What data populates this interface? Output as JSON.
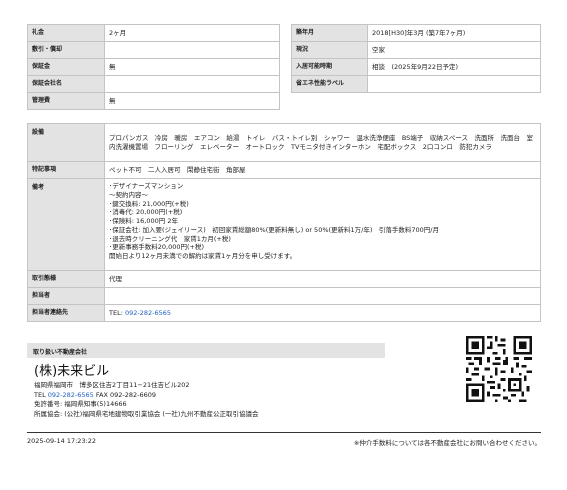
{
  "left_rows": [
    {
      "label": "礼金",
      "value": "2ヶ月"
    },
    {
      "label": "敷引・償却",
      "value": ""
    },
    {
      "label": "保証金",
      "value": "無"
    },
    {
      "label": "保証会社名",
      "value": ""
    },
    {
      "label": "管理費",
      "value": "無"
    }
  ],
  "right_rows": [
    {
      "label": "築年月",
      "value": "2018[H30]年3月 (築7年7ヶ月)"
    },
    {
      "label": "現況",
      "value": "空家"
    },
    {
      "label": "入居可能時期",
      "value": "相談　(2025年9月22日予定)"
    },
    {
      "label": "省エネ性能ラベル",
      "value": ""
    }
  ],
  "facilities": {
    "label": "設備",
    "value": "プロパンガス　冷房　暖房　エアコン　給湯　トイレ　バス・トイレ別　シャワー　温水洗浄便座　BS端子　収納スペース　洗面所　洗面台　室内洗濯機置場　フローリング　エレベーター　オートロック　TVモニタ付きインターホン　宅配ボックス　2口コンロ　防犯カメラ"
  },
  "special": {
    "label": "特記事項",
    "value": "ペット不可　二人入居可　閑静住宅街　角部屋"
  },
  "remarks": {
    "label": "備考",
    "lines": [
      "･デザイナーズマンション",
      "～契約内容～",
      "･鍵交換料: 21,000円(+税)",
      "･消毒代: 20,000円(+税)",
      "･保険料: 16,000円 2年",
      "･保証会社: 加入要(ジェイリース)　初回家賃総額80%(更新料無し) or 50%(更新料1万/年)　引落手数料700円/月",
      "･退去時クリーニング代　家賃1カ月(+税)",
      "･更新事務手数料20,000円(+税)",
      "開始日より12ヶ月未満での解約は家賃1ヶ月分を申し受けます。"
    ]
  },
  "transaction": {
    "label": "取引態様",
    "value": "代理"
  },
  "contact_person": {
    "label": "担当者",
    "value": ""
  },
  "contact_info": {
    "label": "担当者連絡先",
    "tel_prefix": "TEL: ",
    "tel": "092-282-6565"
  },
  "company": {
    "section_label": "取り扱い不動産会社",
    "name": "(株)未来ビル",
    "address": "福岡県福岡市　博多区住吉2丁目11−21住吉ビル202",
    "tel_prefix": "TEL ",
    "tel": "092-282-6565",
    "fax": " FAX 092-282-6609",
    "license": "免許番号: 福岡県知事(5)14666",
    "association": "所属協会: (公社)福岡県宅地建物取引業協会 (一社)九州不動産公正取引協議会"
  },
  "footer": {
    "timestamp": "2025-09-14 17:23:22",
    "note": "※仲介手数料については各不動産会社にお問い合わせください。"
  },
  "colors": {
    "label_bg": "#e3e3e3",
    "link": "#1f5fbf",
    "border": "#c4c4c4"
  },
  "icons": {
    "qr": "qr-code"
  }
}
